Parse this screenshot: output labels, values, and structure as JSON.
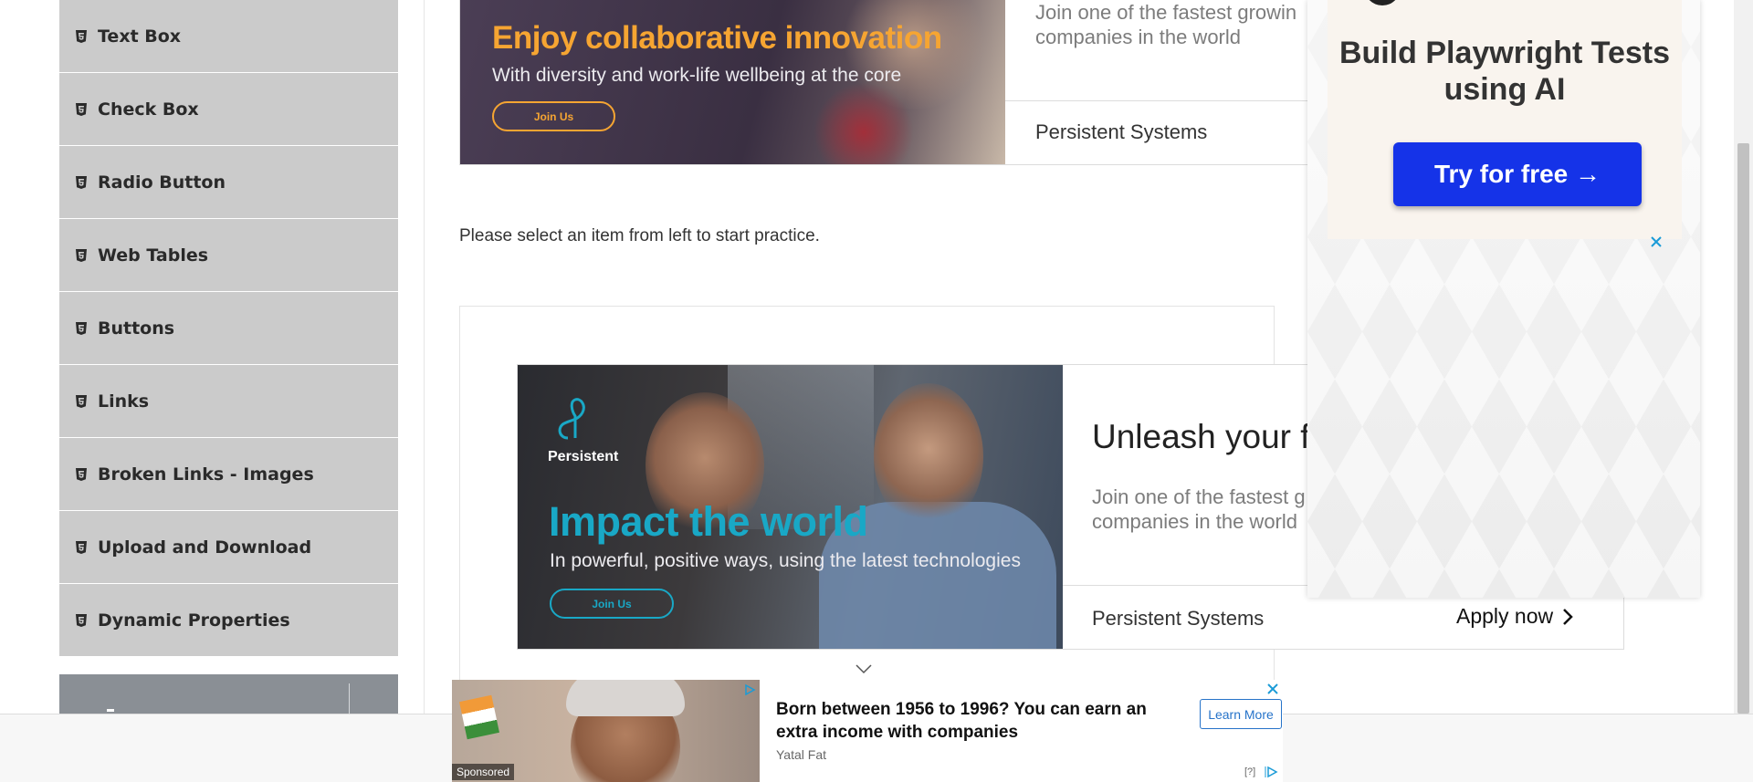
{
  "sidebar": {
    "items": [
      {
        "label": "Text Box"
      },
      {
        "label": "Check Box"
      },
      {
        "label": "Radio Button"
      },
      {
        "label": "Web Tables"
      },
      {
        "label": "Buttons"
      },
      {
        "label": "Links"
      },
      {
        "label": "Broken Links - Images"
      },
      {
        "label": "Upload and Download"
      },
      {
        "label": "Dynamic Properties"
      }
    ]
  },
  "top_ad": {
    "headline": "Enjoy collaborative innovation",
    "subline": "With diversity and work-life wellbeing at the core",
    "cta": "Join Us",
    "description": "Join one of the fastest growin companies in the world",
    "brand": "Persistent Systems"
  },
  "main": {
    "practice_text": "Please select an item from left to start practice."
  },
  "mid_ad": {
    "logo_text": "Persistent",
    "headline": "Impact the world",
    "subline": "In powerful, positive ways, using the latest technologies",
    "cta": "Join Us",
    "title": "Unleash your f",
    "description": "Join one of the fastest g companies in the world",
    "brand": "Persistent Systems",
    "apply": "Apply now"
  },
  "side_ad": {
    "title": "Build Playwright Tests using AI",
    "button": "Try for free →",
    "accent": "#1533e8"
  },
  "bottom_ad": {
    "sponsored": "Sponsored",
    "headline": "Born between 1956 to 1996? You can earn an extra income with companies",
    "source": "Yatal Fat",
    "learn_more": "Learn More",
    "help": "[?]"
  }
}
